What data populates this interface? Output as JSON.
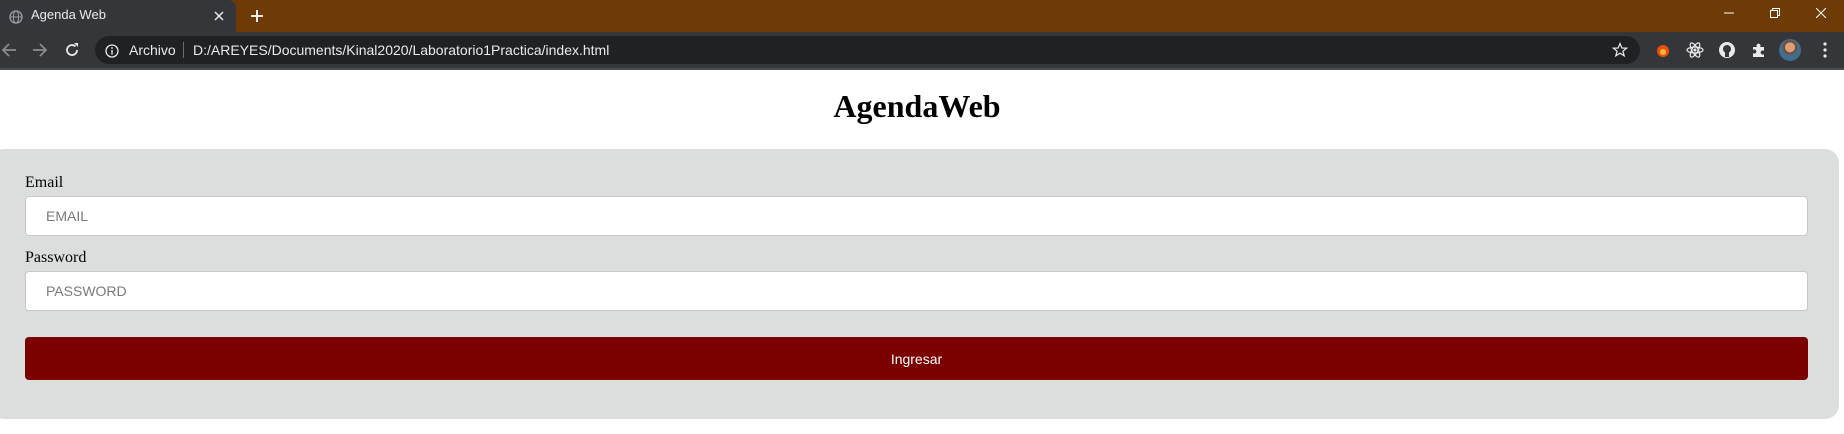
{
  "browser": {
    "tab": {
      "title": "Agenda Web",
      "favicon": "globe-icon"
    },
    "window_controls": [
      "minimize-icon",
      "restore-icon",
      "close-icon"
    ],
    "address_bar": {
      "security_label": "Archivo",
      "url": "D:/AREYES/Documents/Kinal2020/Laboratorio1Practica/index.html"
    },
    "extensions": [
      "fox-extension-icon",
      "react-devtools-icon",
      "github-icon",
      "puzzle-icon"
    ],
    "colors": {
      "frame": "#6e3b06",
      "toolbar": "#35363a",
      "omnibox": "#202124"
    }
  },
  "page": {
    "title": "AgendaWeb",
    "form": {
      "email_label": "Email",
      "email_placeholder": "EMAIL",
      "email_value": "",
      "password_label": "Password",
      "password_placeholder": "PASSWORD",
      "password_value": "",
      "submit_label": "Ingresar"
    },
    "colors": {
      "panel": "#dcdddd",
      "button": "#7b0000",
      "button_text": "#ffffff"
    }
  }
}
